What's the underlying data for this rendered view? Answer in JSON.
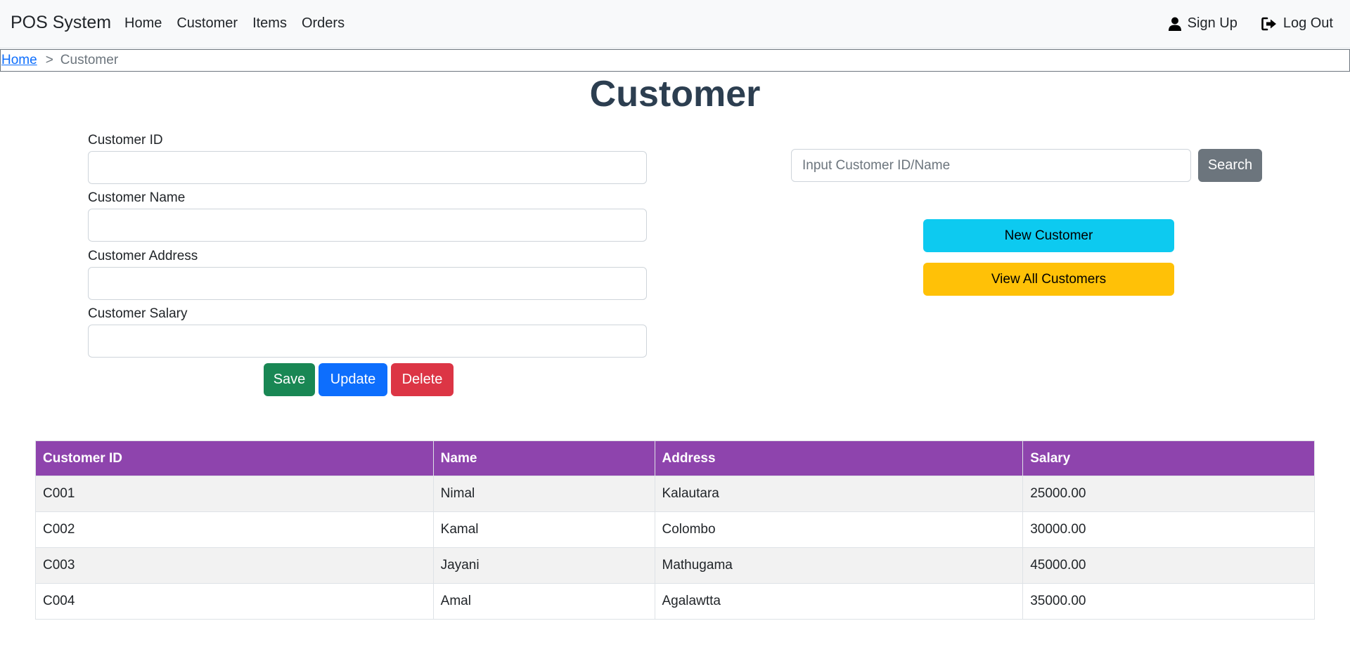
{
  "navbar": {
    "brand": "POS System",
    "links": [
      "Home",
      "Customer",
      "Items",
      "Orders"
    ],
    "sign_up": "Sign Up",
    "log_out": "Log Out"
  },
  "breadcrumb": {
    "home": "Home",
    "separator": ">",
    "current": "Customer"
  },
  "page": {
    "title": "Customer"
  },
  "form": {
    "fields": [
      {
        "label": "Customer ID",
        "value": ""
      },
      {
        "label": "Customer Name",
        "value": ""
      },
      {
        "label": "Customer Address",
        "value": ""
      },
      {
        "label": "Customer Salary",
        "value": ""
      }
    ],
    "save_label": "Save",
    "update_label": "Update",
    "delete_label": "Delete"
  },
  "search": {
    "placeholder": "Input Customer ID/Name",
    "value": "",
    "button_label": "Search"
  },
  "actions": {
    "new_customer": "New Customer",
    "view_all": "View All Customers"
  },
  "table": {
    "headers": [
      "Customer ID",
      "Name",
      "Address",
      "Salary"
    ],
    "rows": [
      [
        "C001",
        "Nimal",
        "Kalautara",
        "25000.00"
      ],
      [
        "C002",
        "Kamal",
        "Colombo",
        "30000.00"
      ],
      [
        "C003",
        "Jayani",
        "Mathugama",
        "45000.00"
      ],
      [
        "C004",
        "Amal",
        "Agalawtta",
        "35000.00"
      ]
    ]
  },
  "colors": {
    "table_header": "#8e44ad",
    "save": "#198754",
    "update": "#0d6efd",
    "delete": "#dc3545",
    "search": "#6c757d",
    "new_customer": "#0dcaf0",
    "view_all": "#ffc107"
  },
  "icons": {
    "sign_up": "user-icon",
    "log_out": "logout-icon"
  }
}
